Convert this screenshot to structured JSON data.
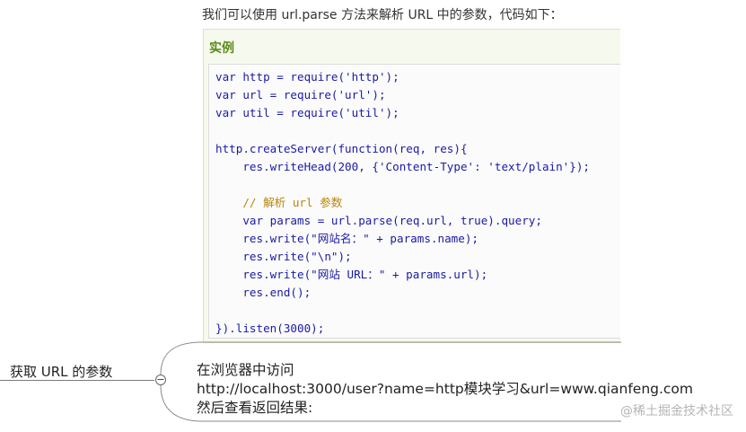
{
  "intro_text": "我们可以使用 url.parse 方法来解析 URL 中的参数，代码如下：",
  "example": {
    "title": "实例",
    "code_lines": [
      "var http = require('http');",
      "var url = require('url');",
      "var util = require('util');",
      "",
      "http.createServer(function(req, res){",
      "    res.writeHead(200, {'Content-Type': 'text/plain'});",
      "",
      "    // 解析 url 参数",
      "    var params = url.parse(req.url, true).query;",
      "    res.write(\"网站名：\" + params.name);",
      "    res.write(\"\\n\");",
      "    res.write(\"网站 URL：\" + params.url);",
      "    res.end();",
      "",
      "}).listen(3000);"
    ]
  },
  "mindmap": {
    "topic": "获取 URL 的参数",
    "collapse_symbol": "−",
    "note_lines": [
      "在浏览器中访问",
      "http://localhost:3000/user?name=http模块学习&url=www.qianfeng.com",
      "然后查看返回结果:"
    ]
  },
  "watermark": "@稀土掘金技术社区"
}
